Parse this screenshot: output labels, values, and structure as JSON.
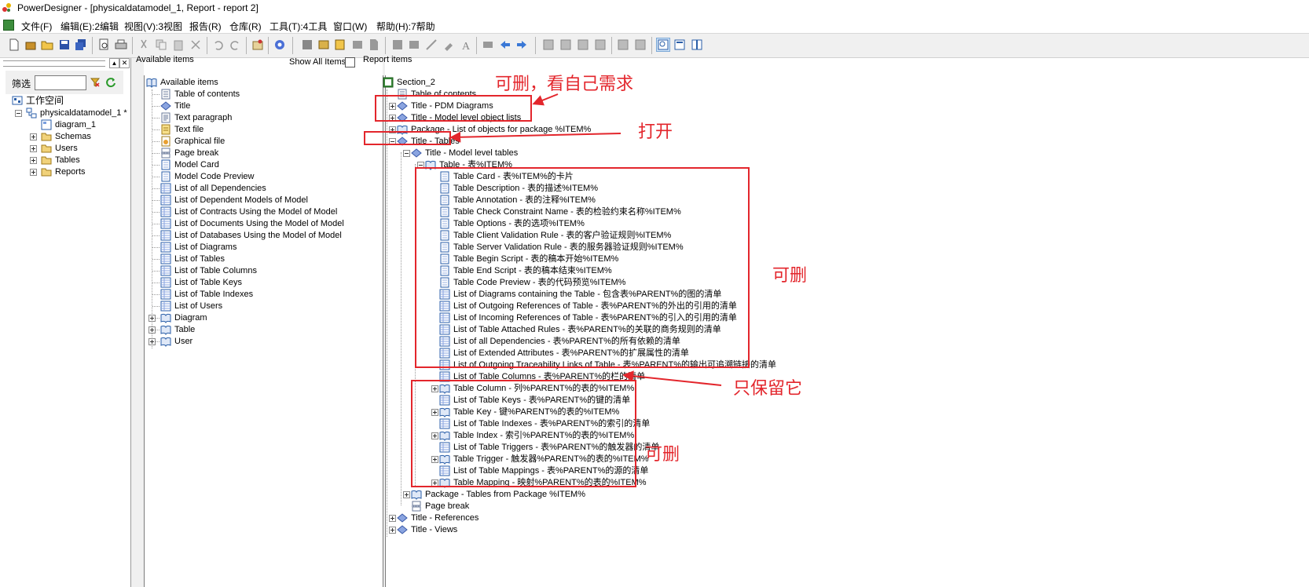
{
  "window": {
    "title": "PowerDesigner - [physicaldatamodel_1, Report - report 2]"
  },
  "menu": [
    {
      "label": "文件(F)"
    },
    {
      "label": "编辑(E):2编辑"
    },
    {
      "label": "视图(V):3视图"
    },
    {
      "label": "报告(R)"
    },
    {
      "label": "仓库(R)"
    },
    {
      "label": "工具(T):4工具"
    },
    {
      "label": "窗口(W)"
    },
    {
      "label": "帮助(H):7帮助"
    }
  ],
  "browser": {
    "filter_label": "筛选",
    "filter_value": "",
    "items": [
      {
        "label": "工作空间"
      },
      {
        "label": "physicaldatamodel_1 *"
      },
      {
        "label": "diagram_1"
      },
      {
        "label": "Schemas"
      },
      {
        "label": "Users"
      },
      {
        "label": "Tables"
      },
      {
        "label": "Reports"
      }
    ]
  },
  "available": {
    "header": "Available items",
    "show_all": "Show All Items",
    "items": [
      {
        "label": "Available items"
      },
      {
        "label": "Table of contents"
      },
      {
        "label": "Title"
      },
      {
        "label": "Text paragraph"
      },
      {
        "label": "Text file"
      },
      {
        "label": "Graphical file"
      },
      {
        "label": "Page break"
      },
      {
        "label": "Model Card"
      },
      {
        "label": "Model Code Preview"
      },
      {
        "label": "List of all Dependencies"
      },
      {
        "label": "List of Dependent Models of Model"
      },
      {
        "label": "List of Contracts Using the Model of Model"
      },
      {
        "label": "List of Documents Using the Model of Model"
      },
      {
        "label": "List of Databases Using the Model of Model"
      },
      {
        "label": "List of Diagrams"
      },
      {
        "label": "List of Tables"
      },
      {
        "label": "List of Table Columns"
      },
      {
        "label": "List of Table Keys"
      },
      {
        "label": "List of Table Indexes"
      },
      {
        "label": "List of Users"
      },
      {
        "label": "Diagram"
      },
      {
        "label": "Table"
      },
      {
        "label": "User"
      }
    ]
  },
  "report": {
    "header": "Report items",
    "items": [
      {
        "label": "Section_2"
      },
      {
        "label": "Table of contents"
      },
      {
        "label": "Title - PDM Diagrams"
      },
      {
        "label": "Title - Model level object lists"
      },
      {
        "label": "Package - List of objects for package %ITEM%"
      },
      {
        "label": "Title - Tables"
      },
      {
        "label": "Title - Model level tables"
      },
      {
        "label": "Table - 表%ITEM%"
      },
      {
        "label": "Table Card - 表%ITEM%的卡片"
      },
      {
        "label": "Table Description - 表的描述%ITEM%"
      },
      {
        "label": "Table Annotation - 表的注释%ITEM%"
      },
      {
        "label": "Table Check Constraint Name - 表的检验约束名称%ITEM%"
      },
      {
        "label": "Table Options - 表的选项%ITEM%"
      },
      {
        "label": "Table Client Validation Rule - 表的客户验证规则%ITEM%"
      },
      {
        "label": "Table Server Validation Rule - 表的服务器验证规则%ITEM%"
      },
      {
        "label": "Table Begin Script - 表的稿本开始%ITEM%"
      },
      {
        "label": "Table End Script - 表的稿本结束%ITEM%"
      },
      {
        "label": "Table Code Preview - 表的代码预览%ITEM%"
      },
      {
        "label": "List of Diagrams containing the Table - 包含表%PARENT%的图的清单"
      },
      {
        "label": "List of Outgoing References of Table - 表%PARENT%的外出的引用的清单"
      },
      {
        "label": "List of Incoming References of Table - 表%PARENT%的引入的引用的清单"
      },
      {
        "label": "List of Table Attached Rules - 表%PARENT%的关联的商务规则的清单"
      },
      {
        "label": "List of all Dependencies - 表%PARENT%的所有依赖的清单"
      },
      {
        "label": "List of Extended Attributes - 表%PARENT%的扩展属性的清单"
      },
      {
        "label": "List of Outgoing Traceability Links of Table - 表%PARENT%的输出可追溯链接的清单"
      },
      {
        "label": "List of Table Columns - 表%PARENT%的栏的清单"
      },
      {
        "label": "Table Column - 列%PARENT%的表的%ITEM%"
      },
      {
        "label": "List of Table Keys - 表%PARENT%的键的清单"
      },
      {
        "label": "Table Key - 键%PARENT%的表的%ITEM%"
      },
      {
        "label": "List of Table Indexes - 表%PARENT%的索引的清单"
      },
      {
        "label": "Table Index - 索引%PARENT%的表的%ITEM%"
      },
      {
        "label": "List of Table Triggers - 表%PARENT%的触发器的清单"
      },
      {
        "label": "Table Trigger - 触发器%PARENT%的表的%ITEM%"
      },
      {
        "label": "List of Table Mappings - 表%PARENT%的源的清单"
      },
      {
        "label": "Table Mapping - 映射%PARENT%的表的%ITEM%"
      },
      {
        "label": "Package - Tables from Package %ITEM%"
      },
      {
        "label": "Page break"
      },
      {
        "label": "Title - References"
      },
      {
        "label": "Title - Views"
      }
    ]
  },
  "annotations": {
    "a1": "可删，看自己需求",
    "a2": "打开",
    "a3": "可删",
    "a4": "只保留它",
    "a5": "可删"
  },
  "colors": {
    "annotation": "#e3262c",
    "toolbar": "#f0f0f0"
  }
}
